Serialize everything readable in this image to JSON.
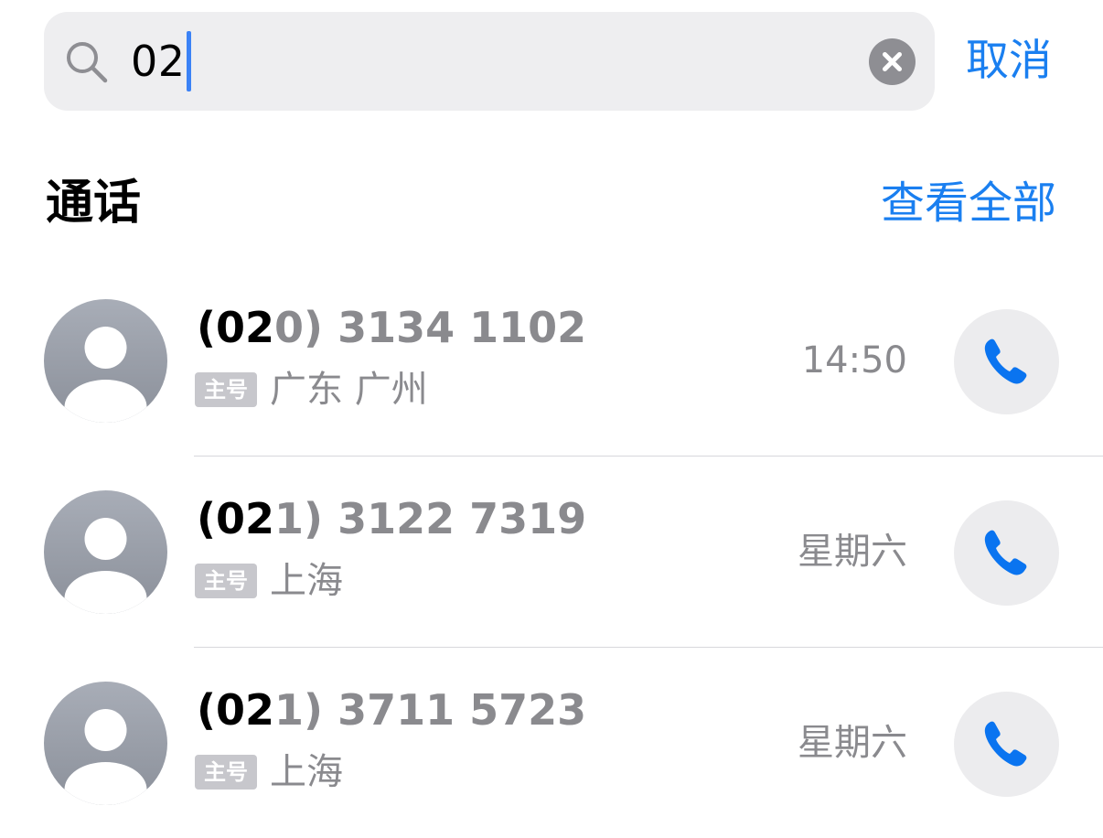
{
  "search": {
    "query": "02",
    "cancel_label": "取消"
  },
  "section": {
    "title": "通话",
    "see_all_label": "查看全部"
  },
  "calls": [
    {
      "number_match": "02",
      "number_prefix": "(",
      "number_rest": "0) 3134 1102",
      "badge": "主号",
      "location": "广东 广州",
      "time": "14:50"
    },
    {
      "number_match": "02",
      "number_prefix": "(",
      "number_rest": "1) 3122 7319",
      "badge": "主号",
      "location": "上海",
      "time": "星期六"
    },
    {
      "number_match": "02",
      "number_prefix": "(",
      "number_rest": "1) 3711 5723",
      "badge": "主号",
      "location": "上海",
      "time": "星期六"
    }
  ],
  "icons": {
    "search": "search-icon",
    "clear": "clear-icon",
    "avatar": "person-icon",
    "call": "phone-icon"
  },
  "colors": {
    "accent": "#1a7ff0",
    "phone_icon": "#0a74f0",
    "secondary_text": "#8a8a8e",
    "badge_bg": "#c7c7cc",
    "field_bg": "#eeeef0"
  }
}
